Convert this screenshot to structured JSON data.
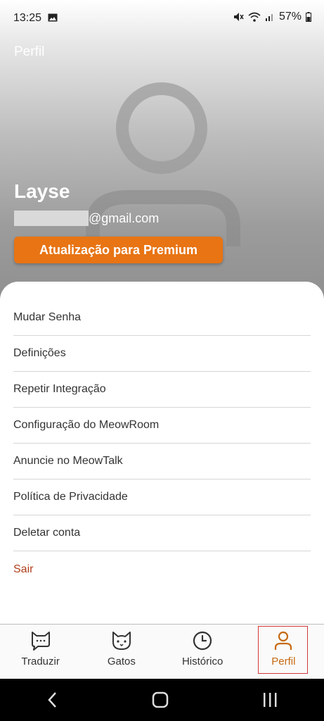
{
  "status": {
    "time": "13:25",
    "battery": "57%"
  },
  "header": {
    "title": "Perfil",
    "user_name": "Layse",
    "email_suffix": "@gmail.com",
    "premium_label": "Atualização para Premium"
  },
  "menu": {
    "items": [
      {
        "label": "Mudar Senha"
      },
      {
        "label": "Definições"
      },
      {
        "label": "Repetir Integração"
      },
      {
        "label": "Configuração do MeowRoom"
      },
      {
        "label": "Anuncie no MeowTalk"
      },
      {
        "label": "Política de Privacidade"
      },
      {
        "label": "Deletar conta"
      }
    ],
    "logout_label": "Sair"
  },
  "bottom_nav": {
    "items": [
      {
        "label": "Traduzir",
        "icon": "cat-chat-icon"
      },
      {
        "label": "Gatos",
        "icon": "cat-face-icon"
      },
      {
        "label": "Histórico",
        "icon": "clock-icon"
      },
      {
        "label": "Perfil",
        "icon": "person-icon"
      }
    ],
    "active_index": 3
  },
  "colors": {
    "accent": "#e87414",
    "active_nav": "#c66a12",
    "logout": "#b0401c"
  }
}
